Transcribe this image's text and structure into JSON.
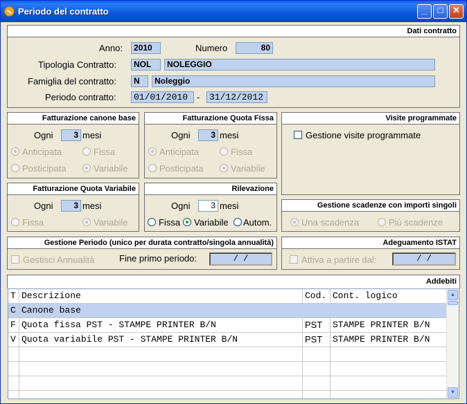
{
  "window": {
    "title": "Periodo del contratto",
    "buttons": {
      "minimize": "_",
      "maximize": "□",
      "close": "✕"
    }
  },
  "dati_contratto": {
    "header": "Dati contratto",
    "anno_label": "Anno:",
    "anno": "2010",
    "numero_label": "Numero",
    "numero": "80",
    "tipologia_label": "Tipologia Contratto:",
    "tipologia_code": "NOL",
    "tipologia_desc": "NOLEGGIO",
    "famiglia_label": "Famiglia del contratto:",
    "famiglia_code": "N",
    "famiglia_desc": "Noleggio",
    "periodo_label": "Periodo contratto:",
    "periodo_da": "01/01/2010",
    "periodo_sep": "-",
    "periodo_a": "31/12/2012"
  },
  "canone_base": {
    "header": "Fatturazione canone base",
    "ogni": "Ogni",
    "value": "3",
    "mesi": "mesi",
    "opt1": "Anticipata",
    "opt2": "Fissa",
    "opt3": "Posticipata",
    "opt4": "Variabile"
  },
  "quota_fissa": {
    "header": "Fatturazione Quota Fissa",
    "ogni": "Ogni",
    "value": "3",
    "mesi": "mesi",
    "opt1": "Anticipata",
    "opt2": "Fissa",
    "opt3": "Posticipata",
    "opt4": "Variabile"
  },
  "visite": {
    "header": "Visite programmate",
    "checkbox": "Gestione visite programmate"
  },
  "quota_variabile": {
    "header": "Fatturazione Quota Variabile",
    "ogni": "Ogni",
    "value": "3",
    "mesi": "mesi",
    "opt1": "Fissa",
    "opt2": "Variabile"
  },
  "rilevazione": {
    "header": "Rilevazione",
    "ogni": "Ogni",
    "value": "3",
    "mesi": "mesi",
    "opt1": "Fissa",
    "opt2": "Variabile",
    "opt3": "Autom."
  },
  "scadenze": {
    "header": "Gestione scadenze con importi singoli",
    "opt1": "Una scadenza",
    "opt2": "Più scadenze"
  },
  "gestione_periodo": {
    "header": "Gestione Periodo (unico per durata contratto/singola annualità)",
    "checkbox": "Gestisci Annualità",
    "fine_label": "Fine primo periodo:",
    "fine_value": "/  /"
  },
  "istat": {
    "header": "Adeguamento ISTAT",
    "checkbox": "Attiva a partire dal:",
    "value": "/  /"
  },
  "addebiti": {
    "header": "Addebiti",
    "columns": [
      "T",
      "Descrizione",
      "Cod.",
      "Cont. logico"
    ],
    "rows": [
      [
        "C",
        "Canone base",
        "",
        ""
      ],
      [
        "F",
        "Quota fissa PST  - STAMPE PRINTER B/N",
        "PST",
        "STAMPE PRINTER B/N"
      ],
      [
        "V",
        "Quota variabile PST  - STAMPE PRINTER B/N",
        "PST",
        "STAMPE PRINTER B/N"
      ]
    ]
  }
}
